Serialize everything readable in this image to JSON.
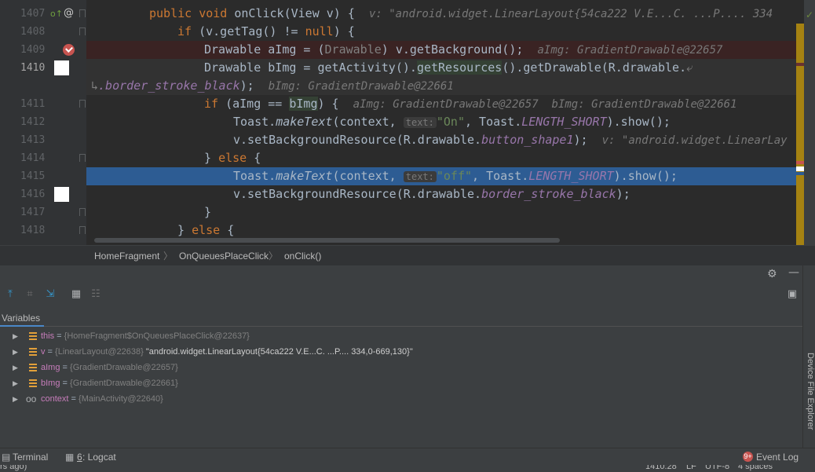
{
  "editor": {
    "gutter": [
      {
        "num": "1407"
      },
      {
        "num": "1408"
      },
      {
        "num": "1409"
      },
      {
        "num": "1410"
      },
      {
        "num": ""
      },
      {
        "num": "1411"
      },
      {
        "num": "1412"
      },
      {
        "num": "1413"
      },
      {
        "num": "1414"
      },
      {
        "num": "1415"
      },
      {
        "num": "1416"
      },
      {
        "num": "1417"
      },
      {
        "num": "1418"
      }
    ],
    "gutter_icons": {
      "override": "o↑",
      "at": "@"
    },
    "code": {
      "l1407_kw1": "public",
      "l1407_kw2": "void",
      "l1407_rest": " onClick(View v) {",
      "l1407_hint": "v: \"android.widget.LinearLayout{54ca222 V.E...C. ...P.... 334",
      "l1408_kw": "if",
      "l1408_rest": " (v.getTag() != ",
      "l1408_null": "null",
      "l1408_end": ") {",
      "l1409_a": "Drawable aImg = (",
      "l1409_cast": "Drawable",
      "l1409_b": ") v.getBackground();",
      "l1409_hint": "aImg: GradientDrawable@22657",
      "l1410_a": "Drawable bImg = getActivity().",
      "l1410_ref": "getResources",
      "l1410_b": "().getDrawable(R.drawable.",
      "l1410_wrap": "⤶",
      "l1410c_arrow": "↳",
      "l1410c_fld": ".border_stroke_black",
      "l1410c_end": ");",
      "l1410c_hint": "bImg: GradientDrawable@22661",
      "l1411_kw": "if",
      "l1411_a": " (aImg == ",
      "l1411_ref": "bImg",
      "l1411_b": ") {",
      "l1411_hint": "aImg: GradientDrawable@22657  bImg: GradientDrawable@22661",
      "l1412_a": "Toast.",
      "l1412_static": "makeText",
      "l1412_b": "(context, ",
      "l1412_hint": "text:",
      "l1412_str": "\"On\"",
      "l1412_c": ", Toast.",
      "l1412_fld": "LENGTH_SHORT",
      "l1412_d": ").show();",
      "l1413_a": "v.setBackgroundResource(R.drawable.",
      "l1413_fld": "button_shape1",
      "l1413_b": ");",
      "l1413_hint": "v: \"android.widget.LinearLay",
      "l1414_a": "} ",
      "l1414_kw": "else",
      "l1414_b": " {",
      "l1415_a": "Toast.",
      "l1415_static": "makeText",
      "l1415_b": "(context, ",
      "l1415_hint": "text:",
      "l1415_str": "\"off\"",
      "l1415_c": ", Toast.",
      "l1415_fld": "LENGTH_SHORT",
      "l1415_d": ").show();",
      "l1416_a": "v.setBackgroundResource(R.drawable.",
      "l1416_fld": "border_stroke_black",
      "l1416_b": ");",
      "l1417": "}",
      "l1418_a": "} ",
      "l1418_kw": "else",
      "l1418_b": " {"
    },
    "warn_glyph": "✓"
  },
  "breadcrumb": {
    "items": [
      "HomeFragment",
      "OnQueuesPlaceClick",
      "onClick()"
    ],
    "separator": "〉"
  },
  "debug_panel": {
    "settings_icon": "⚙",
    "minimize_icon": "—",
    "toolbar_glyphs": [
      "⤒",
      "⌗",
      "⇲",
      "▦",
      "☷"
    ],
    "layout_icon": "▣",
    "variables_title": "Variables",
    "variables": [
      {
        "name": "this",
        "type": "{HomeFragment$OnQueuesPlaceClick@22637}",
        "value": "",
        "icon": "field"
      },
      {
        "name": "v",
        "type": "{LinearLayout@22638}",
        "value": "\"android.widget.LinearLayout{54ca222 V.E...C. ...P.... 334,0-669,130}\"",
        "icon": "field"
      },
      {
        "name": "aImg",
        "type": "{GradientDrawable@22657}",
        "value": "",
        "icon": "field"
      },
      {
        "name": "bImg",
        "type": "{GradientDrawable@22661}",
        "value": "",
        "icon": "field"
      },
      {
        "name": "context",
        "type": "{MainActivity@22640}",
        "value": "",
        "icon": "watch"
      }
    ],
    "eq": " = ",
    "expand_arrow": "▶",
    "watch_glyph": "oo",
    "device_explorer": "Device File Explorer"
  },
  "tool_tabs": {
    "terminal_icon": "▤",
    "terminal": "Terminal",
    "logcat_icon": "▦",
    "logcat_num": "6",
    "logcat": ": Logcat",
    "event_badge": "9+",
    "event_log": "Event Log"
  },
  "status": {
    "left": "rs ago)",
    "position": "1410:28",
    "line_sep": "LF",
    "encoding": "UTF-8",
    "indent": "4 spaces"
  }
}
